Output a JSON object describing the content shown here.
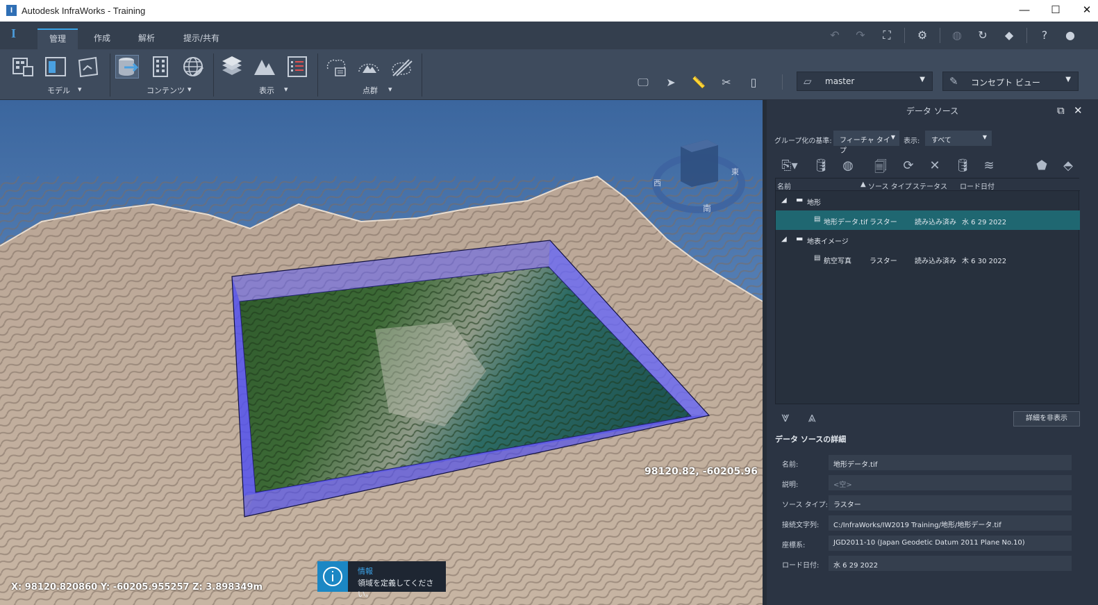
{
  "window": {
    "title": "Autodesk InfraWorks - Training",
    "app_icon_letter": "I",
    "minimize": "—",
    "maximize": "☐",
    "close": "✕"
  },
  "tabs": [
    "管理",
    "作成",
    "解析",
    "提示/共有"
  ],
  "ribbon_groups": [
    "モデル",
    "コンテンツ",
    "表示",
    "点群"
  ],
  "model_dropdown": "master",
  "view_dropdown": "コンセプト ビュー",
  "viewcube": {
    "west": "西",
    "east": "東",
    "south": "南"
  },
  "viewport": {
    "coord_label": "98120.82, -60205.96",
    "coord_bar": "X: 98120.820860 Y: -60205.955257 Z: 3.898349m"
  },
  "toast": {
    "title": "情報",
    "message": "領域を定義してください。"
  },
  "panel": {
    "title": "データ ソース",
    "group_by_label": "グループ化の基準:",
    "group_by_value": "フィーチャ タイプ",
    "display_label": "表示:",
    "display_value": "すべて",
    "columns": [
      "名前",
      "ソース タイプ",
      "ステータス",
      "ロード日付"
    ],
    "groups": [
      {
        "name": "地形",
        "items": [
          {
            "name": "地形データ.tif",
            "type": "ラスター",
            "status": "読み込み済み",
            "date": "水 6 29 2022"
          }
        ]
      },
      {
        "name": "地表イメージ",
        "items": [
          {
            "name": "航空写真",
            "type": "ラスター",
            "status": "読み込み済み",
            "date": "木 6 30 2022"
          }
        ]
      }
    ],
    "hide_details": "詳細を非表示",
    "details_title": "データ ソースの詳細",
    "details": [
      {
        "label": "名前:",
        "value": "地形データ.tif"
      },
      {
        "label": "説明:",
        "value": "<空>"
      },
      {
        "label": "ソース タイプ:",
        "value": "ラスター"
      },
      {
        "label": "接続文字列:",
        "value": "C:/InfraWorks/IW2019 Training/地形/地形データ.tif"
      },
      {
        "label": "座標系:",
        "value": "JGD2011-10 (Japan Geodetic Datum 2011 Plane No.10)"
      },
      {
        "label": "ロード日付:",
        "value": "水 6 29 2022"
      }
    ]
  }
}
